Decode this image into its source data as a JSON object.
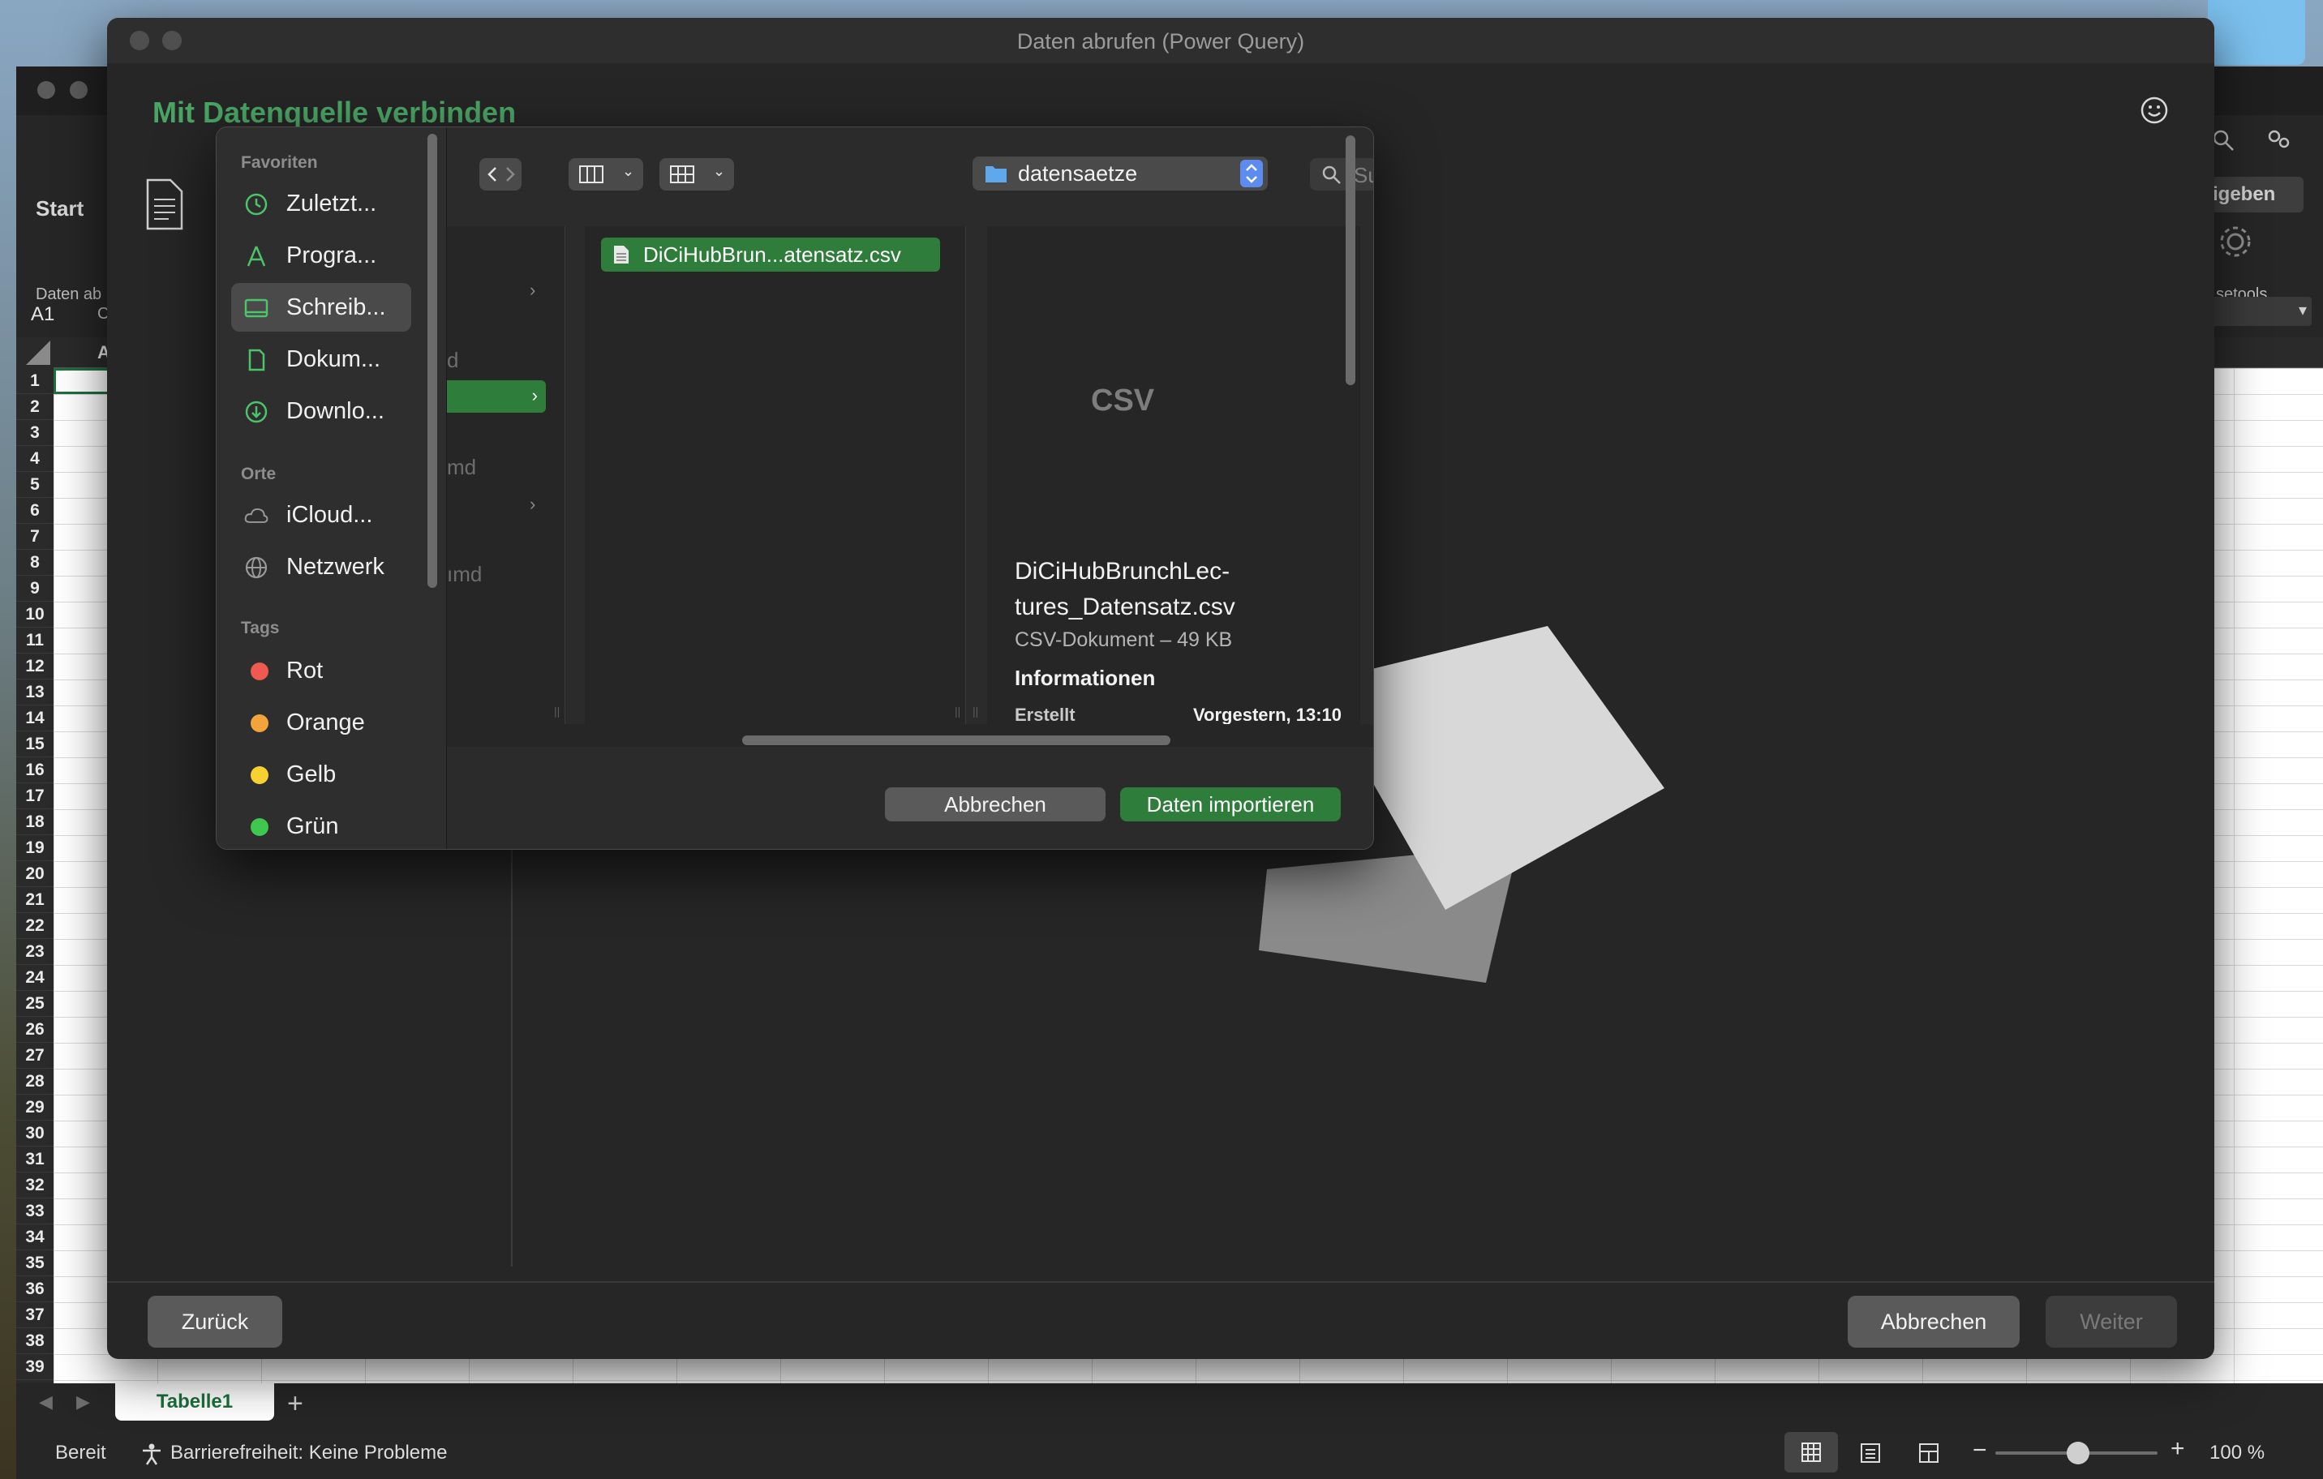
{
  "excel": {
    "ribbon_tab": "Start",
    "ribbon_get_data_label": "Daten ab",
    "ribbon_get_data_sub": "C",
    "ribbon_right_label": "igeben",
    "ribbon_tools_label": "setools",
    "name_box": "A1",
    "col_header_partial": "A",
    "rows": [
      "1",
      "2",
      "3",
      "4",
      "5",
      "6",
      "7",
      "8",
      "9",
      "10",
      "11",
      "12",
      "13",
      "14",
      "15",
      "16",
      "17",
      "18",
      "19",
      "20",
      "21",
      "22",
      "23",
      "24",
      "25",
      "26",
      "27",
      "28",
      "29",
      "30",
      "31",
      "32",
      "33",
      "34",
      "35",
      "36",
      "37",
      "38",
      "39"
    ],
    "sheet_tab": "Tabelle1",
    "status_ready": "Bereit",
    "status_accessibility": "Barrierefreiheit: Keine Probleme",
    "zoom": "100 %"
  },
  "power_query": {
    "window_title": "Daten abrufen (Power Query)",
    "heading": "Mit Datenquelle verbinden",
    "back_button": "Zurück",
    "cancel_button": "Abbrechen",
    "next_button": "Weiter"
  },
  "file_dialog": {
    "sidebar": {
      "favorites_title": "Favoriten",
      "favorites": [
        {
          "label": "Zuletzt...",
          "icon": "clock-icon"
        },
        {
          "label": "Progra...",
          "icon": "apps-icon"
        },
        {
          "label": "Schreib...",
          "icon": "desktop-icon",
          "selected": true
        },
        {
          "label": "Dokum...",
          "icon": "document-icon"
        },
        {
          "label": "Downlo...",
          "icon": "download-icon"
        }
      ],
      "locations_title": "Orte",
      "locations": [
        {
          "label": "iCloud...",
          "icon": "cloud-icon"
        },
        {
          "label": "Netzwerk",
          "icon": "globe-icon"
        }
      ],
      "tags_title": "Tags",
      "tags": [
        {
          "label": "Rot",
          "color": "#ee5a52"
        },
        {
          "label": "Orange",
          "color": "#f2a33a"
        },
        {
          "label": "Gelb",
          "color": "#f5d231"
        },
        {
          "label": "Grün",
          "color": "#3fc74f"
        }
      ]
    },
    "path": "datensaetze",
    "search_placeholder": "Suchen",
    "column1_fragments": [
      "d",
      "md",
      "ımd"
    ],
    "selected_file": "DiCiHubBrun...atensatz.csv",
    "preview": {
      "doc_badge": "CSV",
      "file_name_line1": "DiCiHubBrunchLec-",
      "file_name_line2": "tures_Datensatz.csv",
      "meta": "CSV-Dokument – 49 KB",
      "info_heading": "Informationen",
      "created_label": "Erstellt",
      "created_value": "Vorgestern, 13:10"
    },
    "cancel_button": "Abbrechen",
    "import_button": "Daten importieren"
  },
  "colors": {
    "accent_green": "#2f7d3b",
    "heading_green": "#4aa564"
  }
}
